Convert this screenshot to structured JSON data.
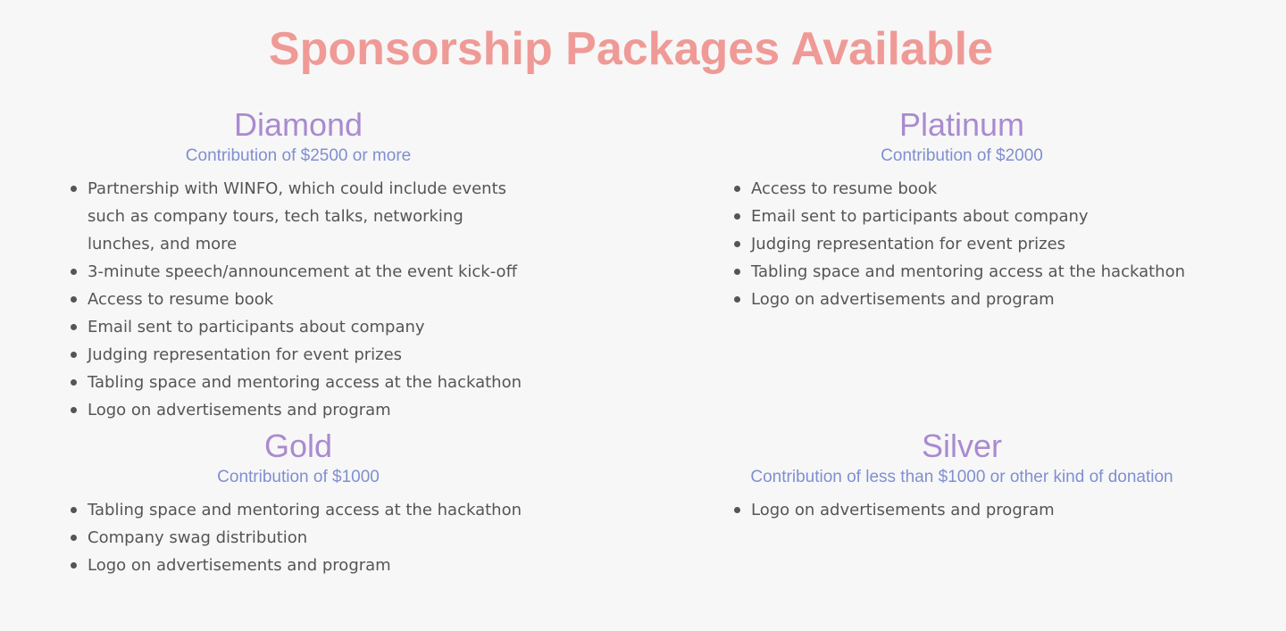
{
  "title": "Sponsorship Packages Available",
  "colors": {
    "title": "#ef9a96",
    "package_name": "#a98bcf",
    "contribution": "#7f8fd1",
    "body_text": "#555555",
    "background": "#f7f7f7"
  },
  "packages": [
    {
      "name": "Diamond",
      "contribution": "Contribution of $2500 or more",
      "benefits": [
        "Partnership with WINFO, which could include events such as company tours, tech talks, networking lunches, and more",
        "3-minute speech/announcement at the event kick-off",
        "Access to resume book",
        "Email sent to participants about company",
        "Judging representation for event prizes",
        "Tabling space and mentoring access at the hackathon",
        "Logo on advertisements and program"
      ]
    },
    {
      "name": "Platinum",
      "contribution": "Contribution of $2000",
      "benefits": [
        "Access to resume book",
        "Email sent to participants about company",
        "Judging representation for event prizes",
        "Tabling space and mentoring access at the hackathon",
        "Logo on advertisements and program"
      ]
    },
    {
      "name": "Gold",
      "contribution": "Contribution of $1000",
      "benefits": [
        "Tabling space and mentoring access at the hackathon",
        "Company swag distribution",
        "Logo on advertisements and program"
      ]
    },
    {
      "name": "Silver",
      "contribution": "Contribution of less than $1000 or other kind of donation",
      "benefits": [
        "Logo on advertisements and program"
      ]
    }
  ]
}
